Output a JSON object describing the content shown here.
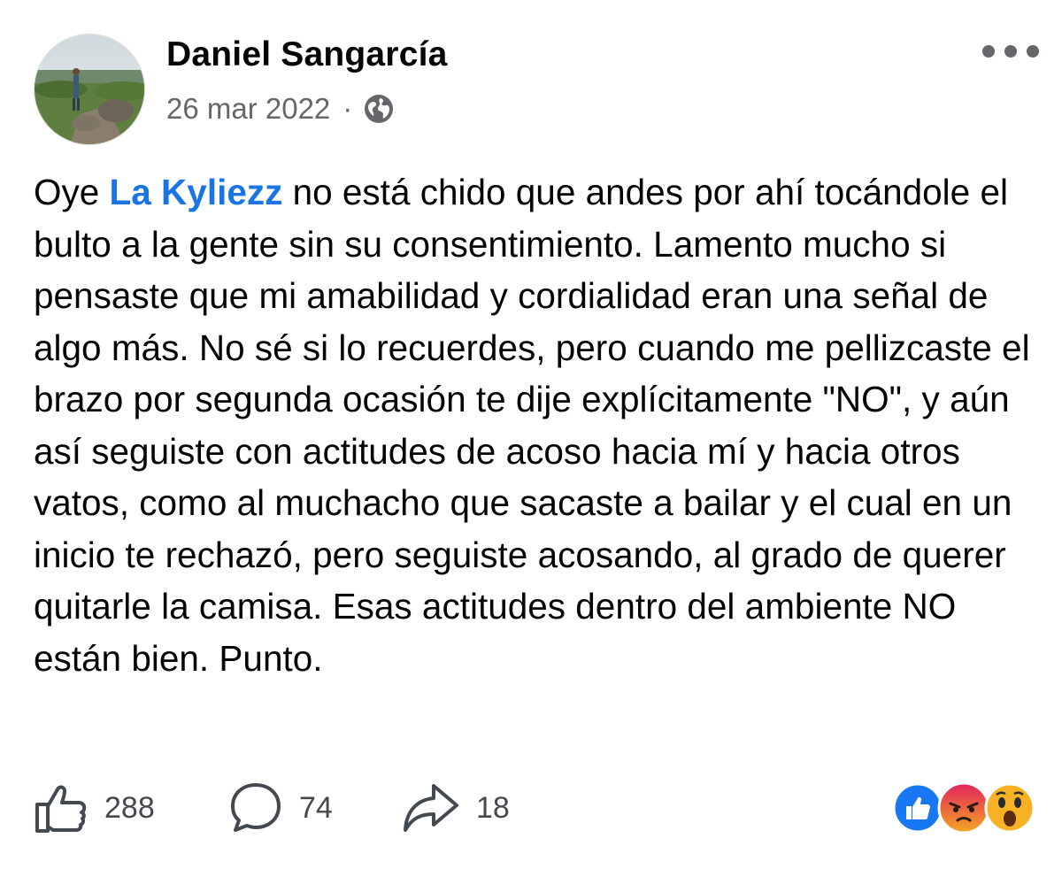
{
  "post": {
    "author": "Daniel Sangarcía",
    "date": "26 mar 2022",
    "separator": "·",
    "privacy_icon": "globe-icon",
    "menu_icon": "more-options-icon",
    "text_before_mention": "Oye ",
    "mention": "La Kyliezz",
    "text_after_mention": " no está chido que andes por ahí tocándole el bulto a la gente sin su consentimiento. Lamento mucho si pensaste que mi amabilidad y cordialidad eran una señal de algo más. No sé si lo recuerdes, pero cuando me pellizcaste el brazo por segunda ocasión te dije explícitamente \"NO\", y aún así seguiste con actitudes de acoso hacia mí y hacia otros vatos, como al muchacho que sacaste a bailar y el cual en un inicio te rechazó, pero seguiste acosando, al grado de querer quitarle la camisa. Esas actitudes dentro del ambiente NO están bien. Punto."
  },
  "stats": {
    "likes": "288",
    "comments": "74",
    "shares": "18"
  },
  "reactions": [
    "like-reaction-icon",
    "angry-reaction-icon",
    "wow-reaction-icon"
  ],
  "colors": {
    "mention": "#1b74e4",
    "meta_text": "#65676b",
    "like_blue": "#1877f2",
    "angry_red": "#e9710f",
    "wow_yellow": "#f7b125"
  }
}
